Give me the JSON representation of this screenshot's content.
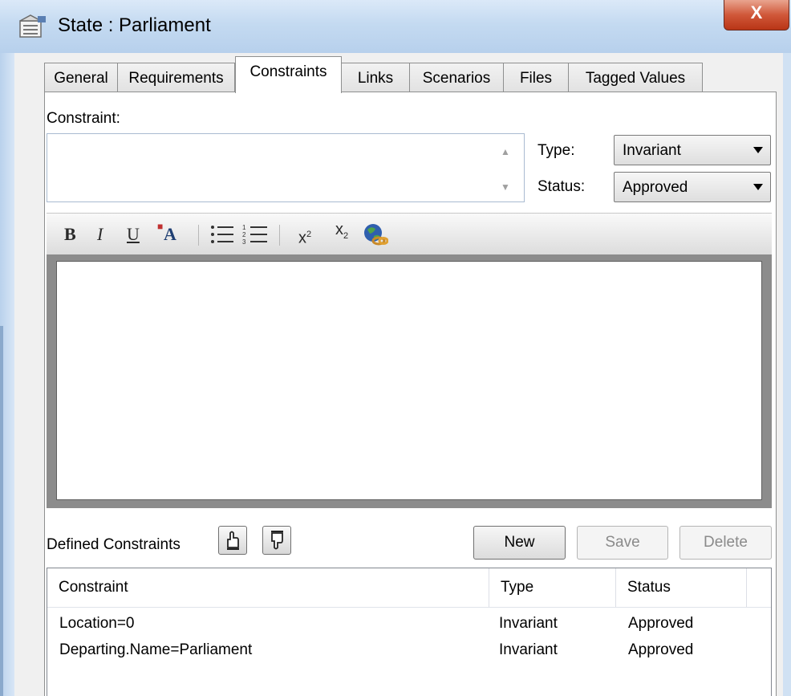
{
  "window": {
    "title": "State : Parliament",
    "close_label": "X"
  },
  "tabs": [
    {
      "label": "General",
      "active": false
    },
    {
      "label": "Requirements",
      "active": false
    },
    {
      "label": "Constraints",
      "active": true
    },
    {
      "label": "Links",
      "active": false
    },
    {
      "label": "Scenarios",
      "active": false
    },
    {
      "label": "Files",
      "active": false
    },
    {
      "label": "Tagged Values",
      "active": false
    }
  ],
  "constraint": {
    "label": "Constraint:",
    "value": ""
  },
  "type_field": {
    "label": "Type:",
    "value": "Invariant"
  },
  "status_field": {
    "label": "Status:",
    "value": "Approved"
  },
  "toolbar": {
    "bold": "B",
    "italic": "I",
    "underline": "U",
    "font_color": "A",
    "superscript": "x",
    "superscript_mark": "2",
    "subscript": "x",
    "subscript_mark": "2",
    "icons": [
      "bold-icon",
      "italic-icon",
      "underline-icon",
      "font-color-icon",
      "bullet-list-icon",
      "numbered-list-icon",
      "superscript-icon",
      "subscript-icon",
      "hyperlink-globe-icon"
    ]
  },
  "defined": {
    "label": "Defined Constraints",
    "new_label": "New",
    "save_label": "Save",
    "delete_label": "Delete"
  },
  "list": {
    "columns": [
      "Constraint",
      "Type",
      "Status"
    ],
    "rows": [
      {
        "constraint": "Location=0",
        "type": "Invariant",
        "status": "Approved"
      },
      {
        "constraint": "Departing.Name=Parliament",
        "type": "Invariant",
        "status": "Approved"
      }
    ]
  }
}
